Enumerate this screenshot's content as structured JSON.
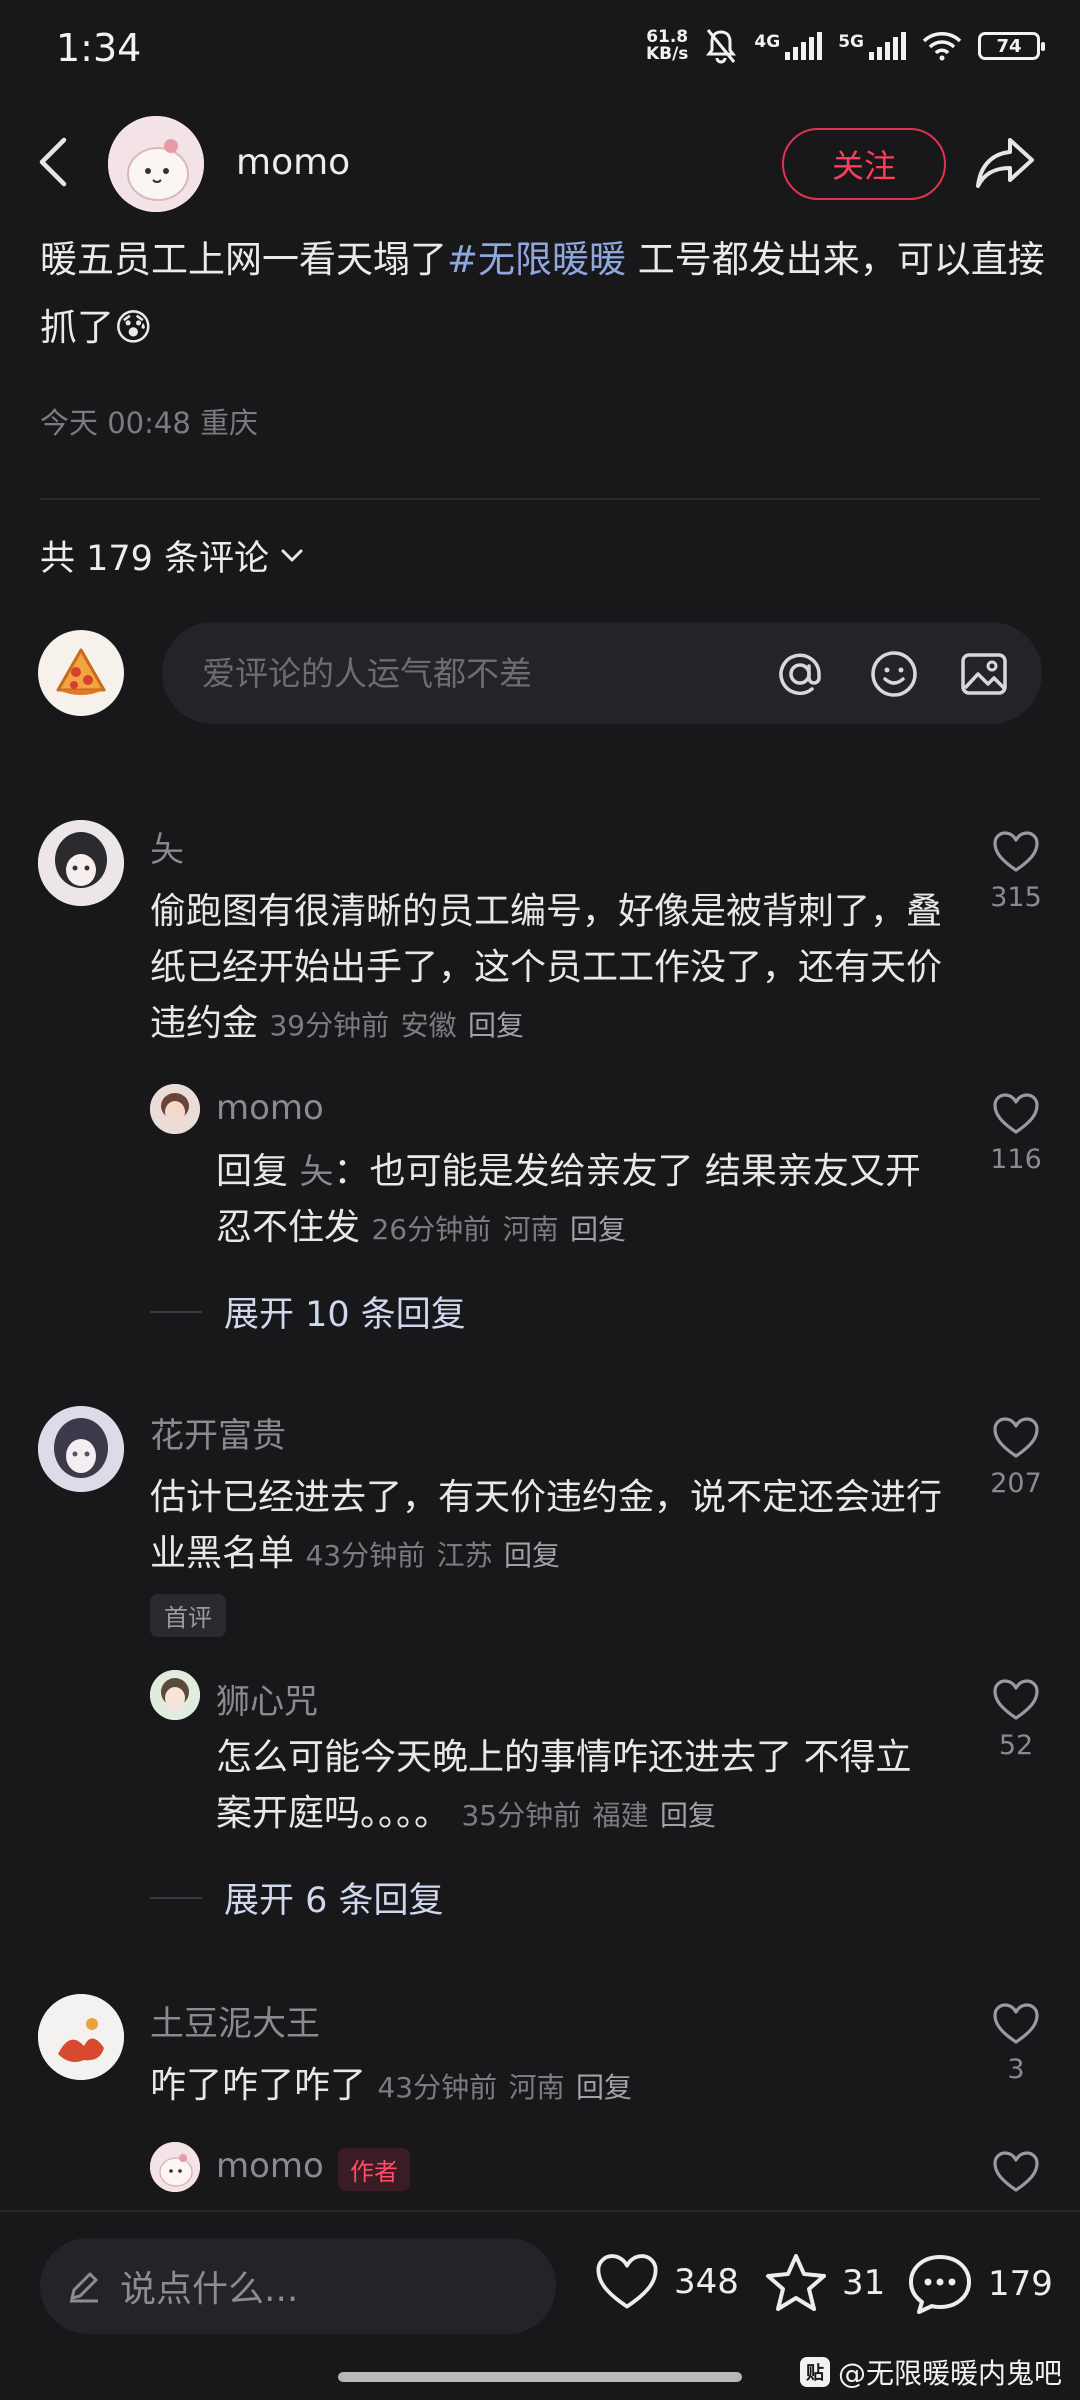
{
  "status_bar": {
    "time": "1:34",
    "net_speed_value": "61.8",
    "net_speed_unit": "KB/s",
    "signal1_label": "4G",
    "signal2_label": "5G",
    "battery": "74"
  },
  "header": {
    "author_name": "momo",
    "follow_label": "关注"
  },
  "post": {
    "text_before": "暖五员工上网一看天塌了",
    "hashtag": "#无限暖暖",
    "text_after": " 工号都发出来，可以直接抓了",
    "emoji": "😰",
    "time": "今天 00:48",
    "location": "重庆"
  },
  "comments_header": {
    "label": "共 179 条评论"
  },
  "comment_input": {
    "placeholder": "爱评论的人运气都不差"
  },
  "comments": [
    {
      "user": "夨",
      "text": "偷跑图有很清晰的员工编号，好像是被背刺了，叠纸已经开始出手了，这个员工工作没了，还有天价违约金",
      "time": "39分钟前",
      "location": "安徽",
      "reply_label": "回复",
      "likes": "315",
      "reply": {
        "user": "momo",
        "prefix": "回复",
        "to": "夨",
        "text": "也可能是发给亲友了 结果亲友又开忍不住发",
        "time": "26分钟前",
        "location": "河南",
        "reply_label": "回复",
        "likes": "116"
      },
      "expand": "展开 10 条回复"
    },
    {
      "user": "花开富贵",
      "text": "估计已经进去了，有天价违约金，说不定还会进行业黑名单",
      "time": "43分钟前",
      "location": "江苏",
      "reply_label": "回复",
      "likes": "207",
      "badge": "首评",
      "reply": {
        "user": "狮心咒",
        "text": "怎么可能今天晚上的事情咋还进去了 不得立案开庭吗。。。。",
        "time": "35分钟前",
        "location": "福建",
        "reply_label": "回复",
        "likes": "52"
      },
      "expand": "展开 6 条回复"
    },
    {
      "user": "土豆泥大王",
      "text": "咋了咋了咋了",
      "time": "43分钟前",
      "location": "河南",
      "reply_label": "回复",
      "likes": "3",
      "reply": {
        "user": "momo",
        "badge": "作者"
      }
    }
  ],
  "bottom_bar": {
    "input_label": "说点什么...",
    "likes": "348",
    "favorites": "31",
    "comments": "179"
  },
  "watermark": {
    "logo": "贴",
    "text": "@无限暖暖内鬼吧"
  }
}
